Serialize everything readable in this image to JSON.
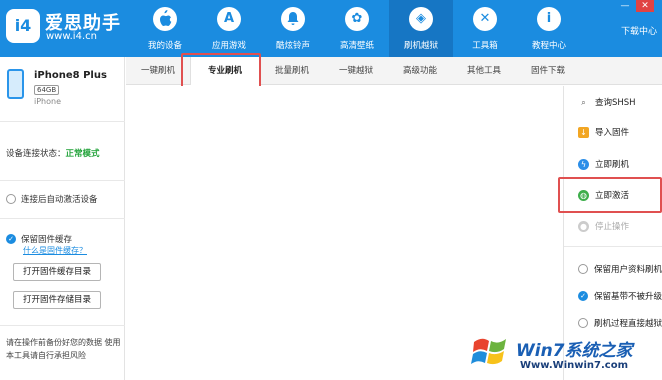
{
  "brand": {
    "logo_text": "i4",
    "name": "爱思助手",
    "url": "www.i4.cn"
  },
  "nav": [
    {
      "label": "我的设备",
      "icon": "apple-icon",
      "glyph": ""
    },
    {
      "label": "应用游戏",
      "icon": "app-store-icon",
      "glyph": "A"
    },
    {
      "label": "酷炫铃声",
      "icon": "bell-icon",
      "glyph": "♪"
    },
    {
      "label": "高清壁纸",
      "icon": "flower-icon",
      "glyph": "✿"
    },
    {
      "label": "刷机越狱",
      "icon": "dropbox-icon",
      "glyph": "◈",
      "active": true
    },
    {
      "label": "工具箱",
      "icon": "tools-icon",
      "glyph": "✕"
    },
    {
      "label": "教程中心",
      "icon": "info-icon",
      "glyph": "i"
    }
  ],
  "window": {
    "download": "下载中心",
    "minimize": "—",
    "close": "✕"
  },
  "device": {
    "name": "iPhone8 Plus",
    "capacity": "64GB",
    "type": "iPhone"
  },
  "status": {
    "label": "设备连接状态：",
    "value": "正常模式"
  },
  "options": {
    "auto_activate": "连接后自动激活设备",
    "keep_cache": "保留固件缓存",
    "what_is_cache": "什么是固件缓存？",
    "open_cache_dir": "打开固件缓存目录",
    "open_store_dir": "打开固件存储目录"
  },
  "warning": "请在操作前备份好您的数据 使用本工具请自行承担风险",
  "tabs": [
    "一键刷机",
    "专业刷机",
    "批量刷机",
    "一键越狱",
    "高级功能",
    "其他工具",
    "固件下载"
  ],
  "right_panel": {
    "query_shsh": "查询SHSH",
    "import_firmware": "导入固件",
    "flash_now": "立即刷机",
    "activate_now": "立即激活",
    "stop": "停止操作",
    "keep_user_data": "保留用户资料刷机",
    "keep_baseband": "保留基带不被升级",
    "direct_activate": "刷机过程直接越狱"
  },
  "watermark": {
    "title": "Win7系统之家",
    "url": "Www.Winwin7.com"
  },
  "colors": {
    "brand_blue": "#1b8ce0",
    "highlight_red": "#e05050",
    "status_green": "#22a33a"
  }
}
